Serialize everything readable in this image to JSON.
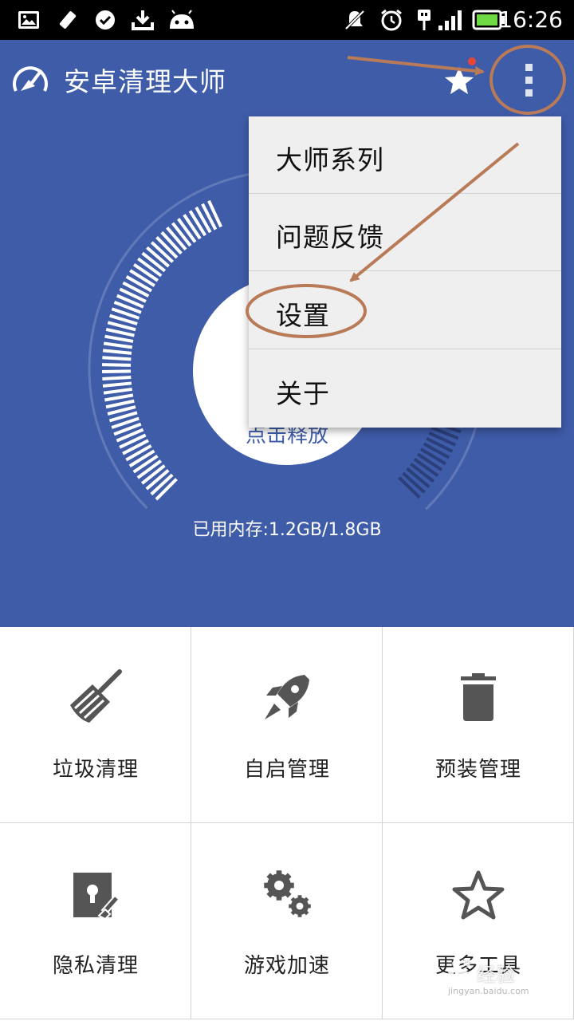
{
  "status_bar": {
    "time": "16:26",
    "icons": [
      "image-icon",
      "no-signal-icon",
      "check-icon",
      "download-icon",
      "android-icon",
      "mute-icon",
      "alarm-icon",
      "usb-icon",
      "signal-icon",
      "battery-icon"
    ]
  },
  "app": {
    "title": "安卓清理大师",
    "accent": "#3f5ca9"
  },
  "memory": {
    "release_label": "点击释放",
    "used_text": "已用内存:1.2GB/1.8GB"
  },
  "menu": {
    "items": [
      {
        "label": "大师系列"
      },
      {
        "label": "问题反馈"
      },
      {
        "label": "设置"
      },
      {
        "label": "关于"
      }
    ]
  },
  "tools": [
    {
      "label": "垃圾清理",
      "icon": "broom-icon"
    },
    {
      "label": "自启管理",
      "icon": "rocket-icon"
    },
    {
      "label": "预装管理",
      "icon": "trash-icon"
    },
    {
      "label": "隐私清理",
      "icon": "privacy-lock-icon"
    },
    {
      "label": "游戏加速",
      "icon": "gears-icon"
    },
    {
      "label": "更多工具",
      "icon": "star-outline-icon"
    }
  ],
  "annotation_color": "#b87a57",
  "watermark": {
    "text": "经验",
    "site": "jingyan.baidu.com"
  }
}
